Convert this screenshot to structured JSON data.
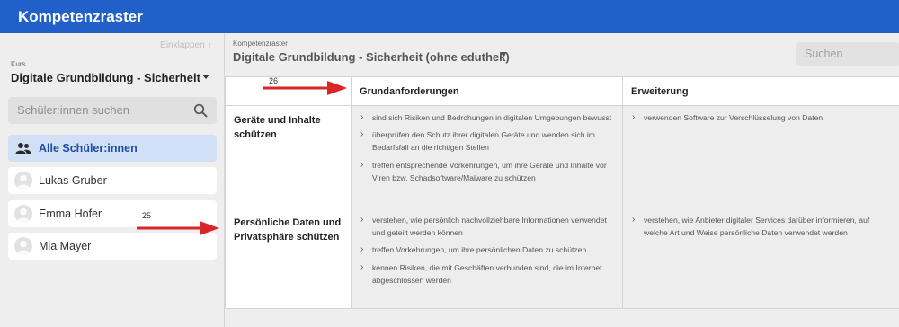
{
  "app": {
    "title": "Kompetenzraster"
  },
  "sidebar": {
    "collapse_label": "Einklappen",
    "course_caption": "Kurs",
    "course_name": "Digitale Grundbildung - Sicherheit",
    "search_placeholder": "Schüler:innen suchen",
    "students": [
      {
        "label": "Alle Schüler:innen",
        "active": true,
        "icon": "group-icon"
      },
      {
        "label": "Lukas Gruber",
        "icon": "avatar"
      },
      {
        "label": "Emma Hofer",
        "icon": "avatar"
      },
      {
        "label": "Mia Mayer",
        "icon": "avatar"
      }
    ]
  },
  "main": {
    "grid_caption": "Kompetenzraster",
    "grid_name": "Digitale Grundbildung - Sicherheit (ohne eduthek)",
    "search_placeholder": "Suchen",
    "columns": [
      "Grundanforderungen",
      "Erweiterung"
    ],
    "rows": [
      {
        "title": "Geräte und Inhalte schützen",
        "basic": [
          "sind sich Risiken und Bedrohungen in digitalen Umgebungen bewusst",
          "überprüfen den Schutz ihrer digitalen Geräte und wenden sich im Bedarfsfall an die richtigen Stellen",
          "treffen entsprechende Vorkehrungen, um ihre Geräte und Inhalte vor Viren bzw. Schadsoftware/Malware zu schützen"
        ],
        "extended": [
          "verwenden Software zur Verschlüsselung von Daten"
        ]
      },
      {
        "title": "Persönliche Daten und Privatsphäre schützen",
        "basic": [
          "verstehen, wie persönlich nachvollziehbare Informationen verwendet und geteilt werden können",
          "treffen Vorkehrungen, um ihre persönlichen Daten zu schützen",
          "kennen Risiken, die mit Geschäften verbunden sind, die im Internet abgeschlossen werden"
        ],
        "extended": [
          "verstehen, wie Anbieter digitaler Services darüber informieren, auf welche Art und Weise persönliche Daten verwendet werden"
        ]
      }
    ]
  },
  "annotations": [
    {
      "number": "26",
      "color": "#d9262b"
    },
    {
      "number": "25",
      "color": "#d9262b"
    }
  ]
}
